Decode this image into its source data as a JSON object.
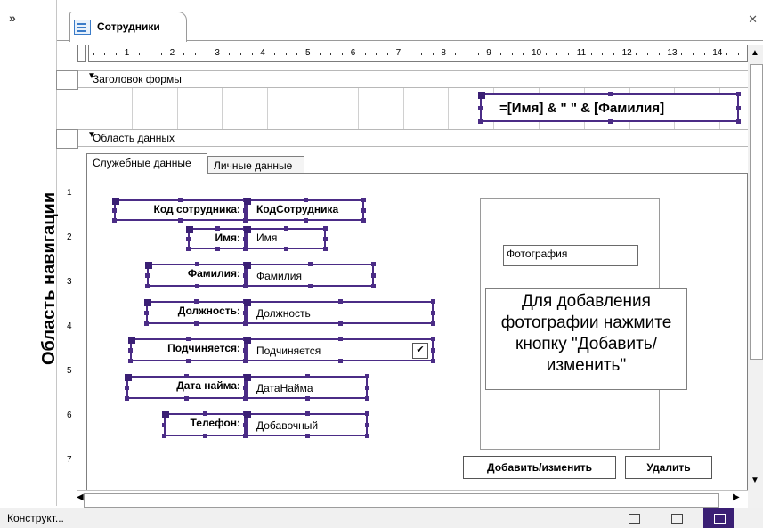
{
  "navigation_pane": {
    "title": "Область навигации",
    "toggle_icon": "chevron-double-right-icon"
  },
  "document": {
    "tab_label": "Сотрудники",
    "tab_icon": "form-icon",
    "close_icon": "close-icon"
  },
  "ruler": {
    "numbers": [
      "1",
      "2",
      "3",
      "4",
      "5",
      "6",
      "7",
      "8",
      "9",
      "10",
      "11",
      "12",
      "13",
      "14",
      "1"
    ],
    "vertical_numbers": [
      "1",
      "2",
      "3",
      "4",
      "5",
      "6",
      "7"
    ]
  },
  "sections": {
    "header": "Заголовок формы",
    "detail": "Область данных"
  },
  "header_expression": "=[Имя] & \" \" & [Фамилия]",
  "tabs": [
    {
      "label": "Служебные данные",
      "active": true
    },
    {
      "label": "Личные данные",
      "active": false
    }
  ],
  "fields": [
    {
      "label": "Код сотрудника:",
      "control": "КодСотрудника",
      "bold_control": true
    },
    {
      "label": "Имя:",
      "control": "Имя"
    },
    {
      "label": "Фамилия:",
      "control": "Фамилия"
    },
    {
      "label": "Должность:",
      "control": "Должность"
    },
    {
      "label": "Подчиняется:",
      "control": "Подчиняется",
      "combo": true
    },
    {
      "label": "Дата найма:",
      "control": "ДатаНайма"
    },
    {
      "label": "Телефон:",
      "control": "Добавочный"
    }
  ],
  "photo": {
    "field_label": "Фотография",
    "hint": "Для добавления фотографии нажмите кнопку \"Добавить/изменить\""
  },
  "buttons": {
    "add_change": "Добавить/изменить",
    "delete": "Удалить"
  },
  "status": {
    "text": "Конструкт..."
  },
  "colors": {
    "selection": "#4b2c86",
    "active_view": "#3a1f74"
  }
}
